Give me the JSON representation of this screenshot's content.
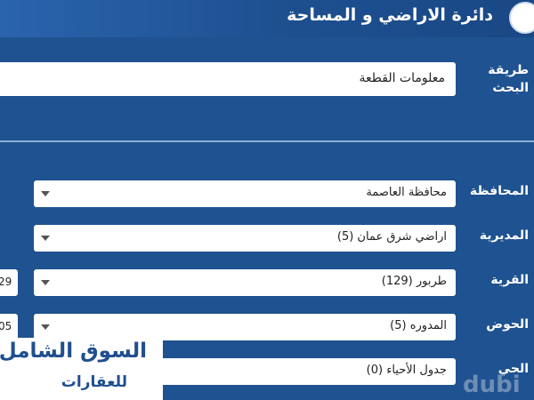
{
  "header": {
    "title": "دائرة الاراضي و المساحة"
  },
  "search": {
    "method_label_line1": "طريقة",
    "method_label_line2": "البحث",
    "method_value": "معلومات القطعة"
  },
  "form": {
    "governorate": {
      "label": "المحافظة",
      "value": "محافظة العاصمة"
    },
    "directorate": {
      "label": "المديرية",
      "value": "اراضي شرق عمان (5)"
    },
    "village": {
      "label": "القرية",
      "value": "طربور (129)",
      "side": "29"
    },
    "basin": {
      "label": "الحوض",
      "value": "المدوره (5)",
      "side": "05"
    },
    "district": {
      "label": "الحي",
      "value": "جدول الأحياء (0)"
    }
  },
  "watermark": {
    "line1": "السوق الشامل",
    "line2": "للعقارات",
    "brand": "dubi"
  }
}
